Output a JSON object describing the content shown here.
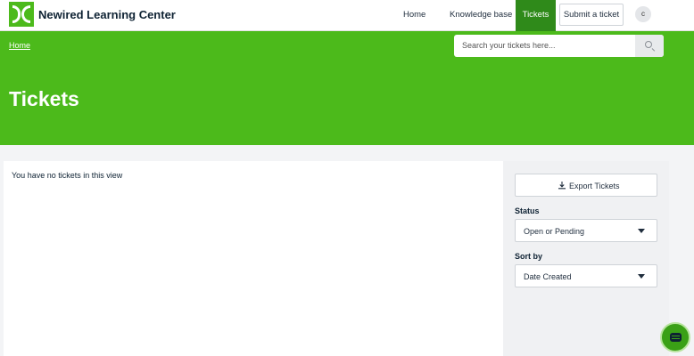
{
  "header": {
    "brand": "Newired Learning Center",
    "nav": {
      "home": "Home",
      "knowledge_base": "Knowledge base",
      "tickets": "Tickets",
      "submit": "Submit a ticket"
    },
    "avatar_initial": "c"
  },
  "hero": {
    "breadcrumb": "Home",
    "search_placeholder": "Search your tickets here...",
    "title": "Tickets"
  },
  "main": {
    "empty_message": "You have no tickets in this view"
  },
  "sidebar": {
    "export_label": "Export Tickets",
    "status_label": "Status",
    "status_value": "Open or Pending",
    "sort_label": "Sort by",
    "sort_value": "Date Created"
  },
  "colors": {
    "brand_green": "#4cba1b",
    "active_tab": "#2f8a1a"
  }
}
